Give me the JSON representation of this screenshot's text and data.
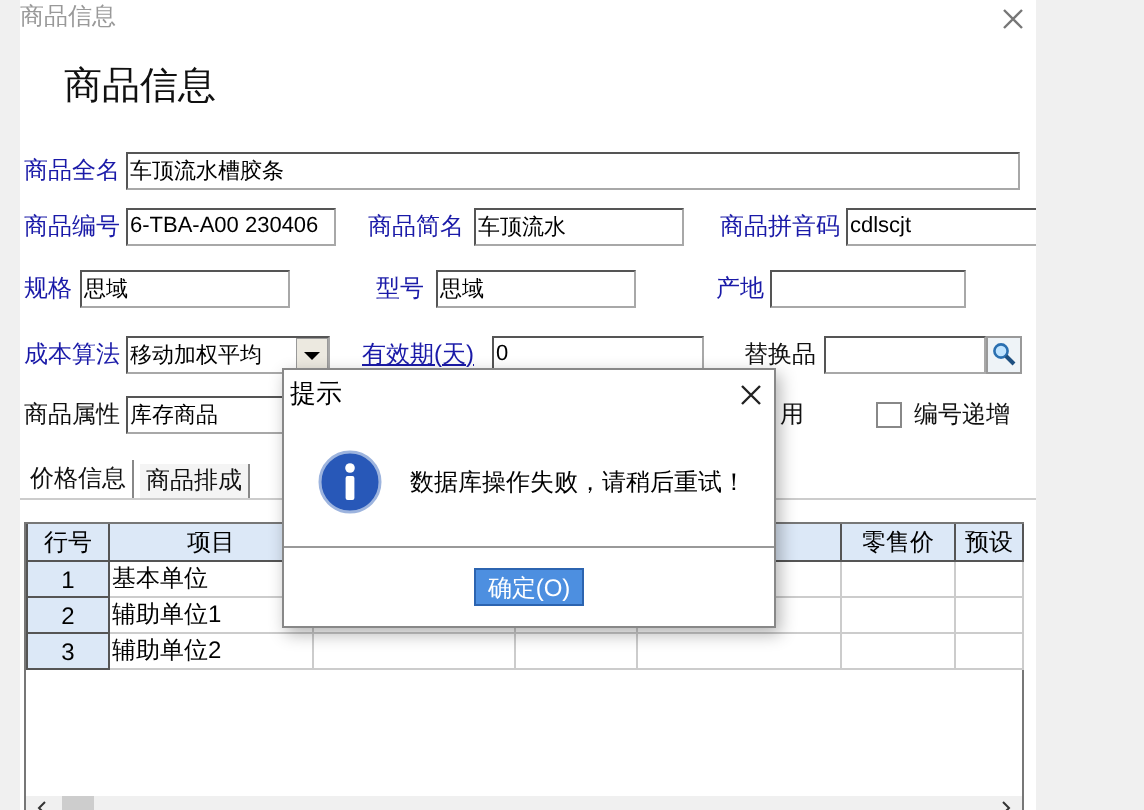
{
  "window": {
    "title": "商品信息",
    "heading": "商品信息"
  },
  "form_rows": [
    [
      {
        "label": {
          "text": "商品全名",
          "kind": "required"
        },
        "kind": "field",
        "value": "车顶流水槽胶条"
      }
    ],
    [
      {
        "label": {
          "text": "商品编号",
          "kind": "required"
        },
        "kind": "field",
        "value": "6-TBA-A00 230406"
      },
      {
        "label": {
          "text": "商品简名",
          "kind": "required"
        },
        "kind": "field",
        "value": "车顶流水"
      },
      {
        "label": {
          "text": "商品拼音码",
          "kind": "required"
        },
        "kind": "field",
        "value": "cdlscjt"
      }
    ],
    [
      {
        "label": {
          "text": "规格",
          "kind": "required"
        },
        "kind": "field",
        "value": "思域"
      },
      {
        "label": {
          "text": "型号",
          "kind": "required"
        },
        "kind": "field",
        "value": "思域"
      },
      {
        "label": {
          "text": "产地",
          "kind": "required"
        },
        "kind": "field"
      }
    ],
    [
      {
        "label": {
          "text": "成本算法",
          "kind": "required"
        },
        "kind": "select",
        "value": "移动加权平均"
      },
      {
        "label": {
          "text": "有效期(天)",
          "kind": "link"
        },
        "kind": "field",
        "value": "0"
      },
      {
        "label": {
          "text": "替换品",
          "kind": "plain"
        },
        "kind": "lookup"
      }
    ],
    [
      {
        "label": {
          "text": "商品属性",
          "kind": "plain"
        },
        "kind": "field",
        "value": "库存商品"
      }
    ]
  ],
  "partial_label": "用",
  "checkbox": {
    "label": "编号递增",
    "checked": false
  },
  "tabs": [
    {
      "label": "价格信息",
      "selected": true
    },
    {
      "label": "商品排成",
      "selected": false
    }
  ],
  "table": {
    "columns": [
      {
        "label": "行号"
      },
      {
        "label": "项目"
      },
      {},
      {},
      {},
      {
        "label": "零售价"
      },
      {
        "label": "预设"
      }
    ],
    "rows": [
      {
        "number": "1",
        "item": "基本单位"
      },
      {
        "number": "2",
        "item": "辅助单位1"
      },
      {
        "number": "3",
        "item": "辅助单位2"
      }
    ]
  },
  "dialog": {
    "title": "提示",
    "message": "数据库操作失败，请稍后重试！",
    "button": "确定(O)"
  }
}
